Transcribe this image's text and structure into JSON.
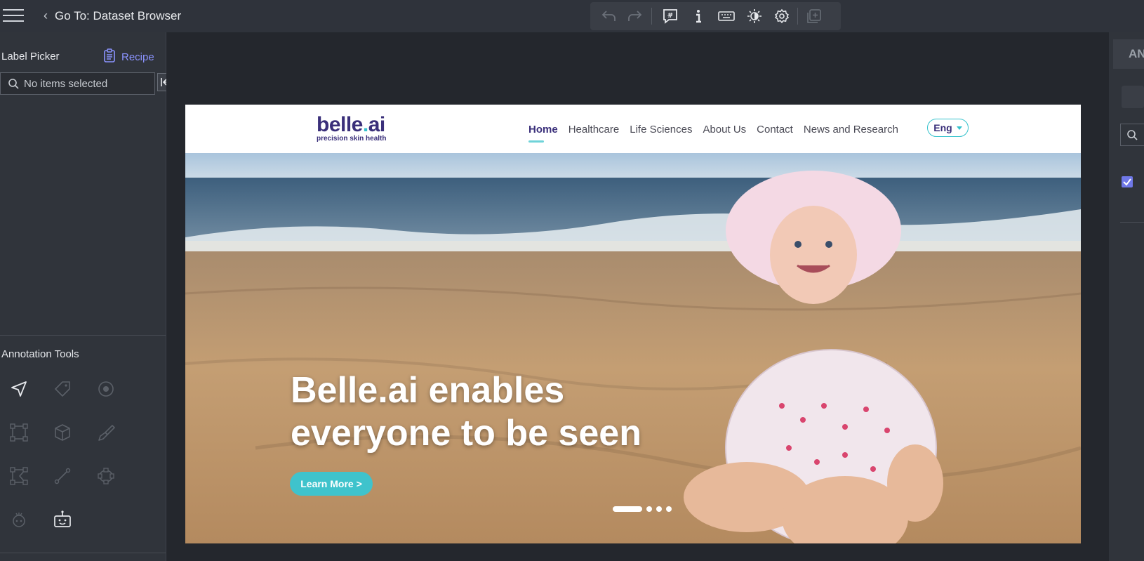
{
  "header": {
    "back_label": "Go To: Dataset Browser",
    "icons": [
      "menu-icon",
      "chevron-left-icon",
      "undo-icon",
      "redo-icon",
      "hashtag-icon",
      "info-icon",
      "keyboard-icon",
      "brightness-icon",
      "settings-icon",
      "add-icon"
    ]
  },
  "left_panel": {
    "label_picker_title": "Label Picker",
    "recipe_label": "Recipe",
    "search_placeholder": "No items selected",
    "annotation_tools_title": "Annotation Tools",
    "tools": [
      "pointer-tool",
      "tag-tool",
      "point-tool",
      "box-tool",
      "cube-tool",
      "brush-tool",
      "polygon-tool",
      "line-tool",
      "ellipse-tool",
      "ai-tool",
      "bot-tool"
    ]
  },
  "site": {
    "logo_name_a": "belle",
    "logo_dot": ".",
    "logo_name_b": "ai",
    "logo_tagline": "precision skin health",
    "nav": [
      {
        "label": "Home",
        "active": true
      },
      {
        "label": "Healthcare"
      },
      {
        "label": "Life Sciences"
      },
      {
        "label": "About Us"
      },
      {
        "label": "Contact"
      },
      {
        "label": "News and Research"
      }
    ],
    "language": "Eng",
    "headline_line1": "Belle.ai enables",
    "headline_line2": "everyone to be seen",
    "cta_label": "Learn More >",
    "slides": {
      "count": 4,
      "active": 1
    }
  },
  "right_panel": {
    "tab_label": "AN"
  },
  "colors": {
    "accent": "#8b93ff",
    "brand": "#3a2f7a",
    "teal": "#3fc3cc",
    "checkbox": "#6f78e8"
  }
}
